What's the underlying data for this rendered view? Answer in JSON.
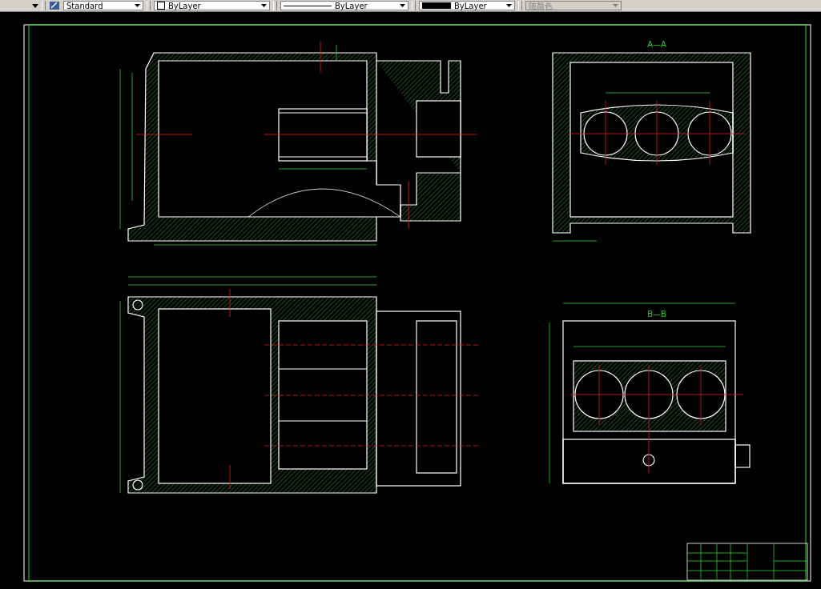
{
  "toolbar": {
    "controls": [
      {
        "kind": "textstyle",
        "text": "Standard",
        "disabled": false
      },
      {
        "kind": "color",
        "text": "ByLayer",
        "disabled": false
      },
      {
        "kind": "linetype",
        "text": "ByLayer",
        "disabled": false
      },
      {
        "kind": "lineweight",
        "text": "ByLayer",
        "disabled": false
      },
      {
        "kind": "plotstyle",
        "text": "随颜色",
        "disabled": true
      }
    ]
  },
  "drawing": {
    "section_labels": [
      "A—A",
      "B—B"
    ]
  }
}
